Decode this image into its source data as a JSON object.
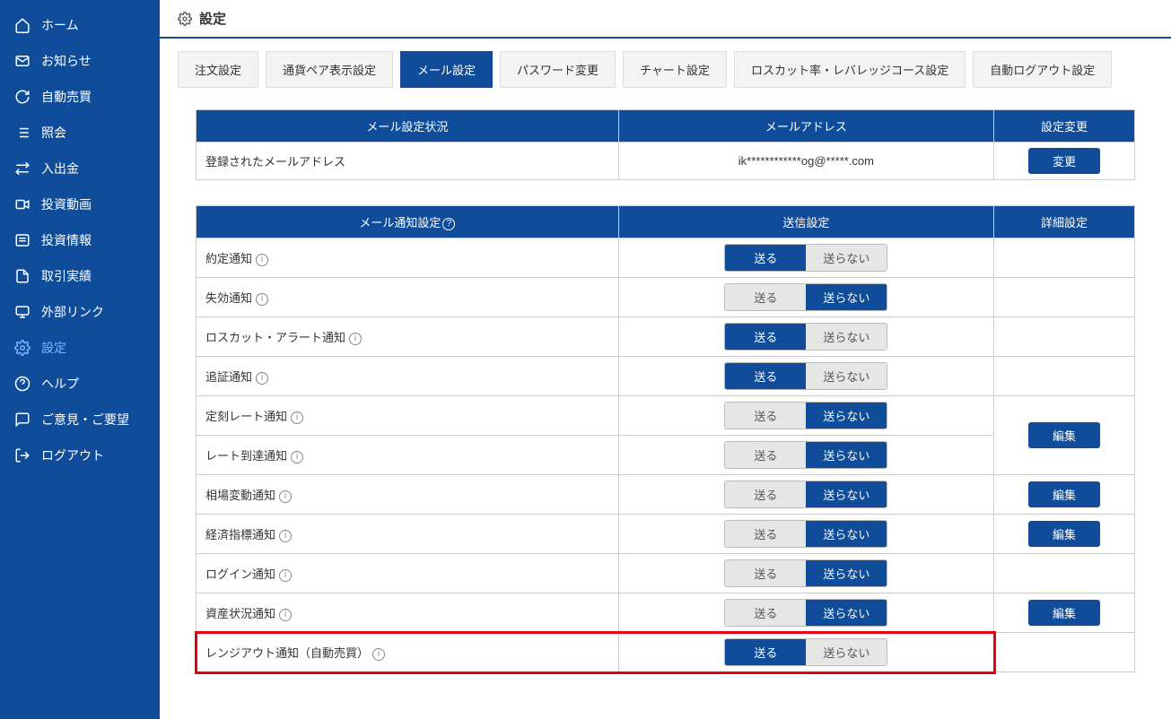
{
  "sidebar": {
    "items": [
      {
        "label": "ホーム",
        "icon": "home"
      },
      {
        "label": "お知らせ",
        "icon": "mail"
      },
      {
        "label": "自動売買",
        "icon": "auto"
      },
      {
        "label": "照会",
        "icon": "list"
      },
      {
        "label": "入出金",
        "icon": "transfer"
      },
      {
        "label": "投資動画",
        "icon": "video"
      },
      {
        "label": "投資情報",
        "icon": "news"
      },
      {
        "label": "取引実績",
        "icon": "doc"
      },
      {
        "label": "外部リンク",
        "icon": "monitor"
      },
      {
        "label": "設定",
        "icon": "gear",
        "active": true
      },
      {
        "label": "ヘルプ",
        "icon": "help"
      },
      {
        "label": "ご意見・ご要望",
        "icon": "chat"
      },
      {
        "label": "ログアウト",
        "icon": "logout"
      }
    ]
  },
  "page_title": "設定",
  "tabs": [
    {
      "label": "注文設定"
    },
    {
      "label": "通貨ペア表示設定"
    },
    {
      "label": "メール設定",
      "active": true
    },
    {
      "label": "パスワード変更"
    },
    {
      "label": "チャート設定"
    },
    {
      "label": "ロスカット率・レバレッジコース設定"
    },
    {
      "label": "自動ログアウト設定"
    }
  ],
  "email_table": {
    "headers": {
      "col1": "メール設定状況",
      "col2": "メールアドレス",
      "col3": "設定変更"
    },
    "row": {
      "status": "登録されたメールアドレス",
      "address": "ik************og@*****.com",
      "button": "変更"
    }
  },
  "notify_table": {
    "headers": {
      "col1": "メール通知設定",
      "col2": "送信設定",
      "col3": "詳細設定"
    },
    "send_label": "送る",
    "nosend_label": "送らない",
    "edit_label": "編集",
    "rows": [
      {
        "label": "約定通知",
        "send_active": "send",
        "detail": null
      },
      {
        "label": "失効通知",
        "send_active": "nosend",
        "detail": null
      },
      {
        "label": "ロスカット・アラート通知",
        "send_active": "send",
        "detail": null
      },
      {
        "label": "追証通知",
        "send_active": "send",
        "detail": null
      },
      {
        "label": "定刻レート通知",
        "send_active": "nosend",
        "detail": "edit",
        "merge_top": true
      },
      {
        "label": "レート到達通知",
        "send_active": "nosend",
        "detail": null
      },
      {
        "label": "相場変動通知",
        "send_active": "nosend",
        "detail": "edit"
      },
      {
        "label": "経済指標通知",
        "send_active": "nosend",
        "detail": "edit"
      },
      {
        "label": "ログイン通知",
        "send_active": "nosend",
        "detail": null
      },
      {
        "label": "資産状況通知",
        "send_active": "nosend",
        "detail": "edit"
      },
      {
        "label": "レンジアウト通知（自動売買）",
        "send_active": "send",
        "detail": null,
        "highlight": true
      }
    ]
  }
}
